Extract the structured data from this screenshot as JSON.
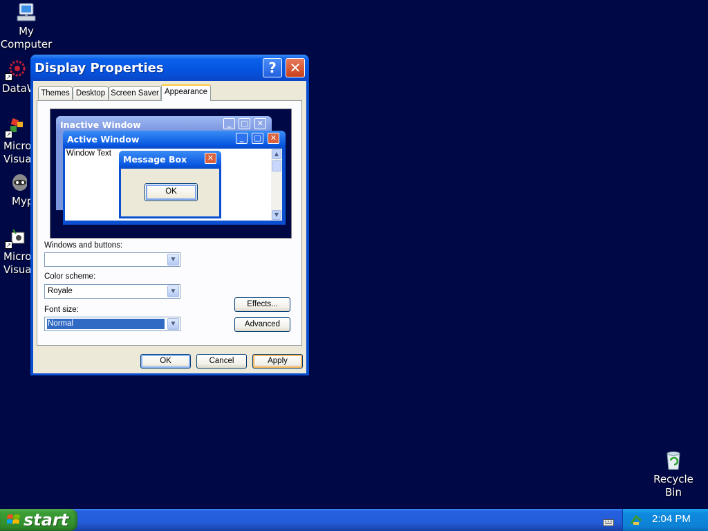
{
  "desktop": {
    "icons": [
      {
        "label": "My\nComputer",
        "name": "my-computer"
      },
      {
        "label": "DataW",
        "name": "dataw"
      },
      {
        "label": "Micro\nVisua",
        "name": "micro-visua-1"
      },
      {
        "label": "Myp",
        "name": "myp"
      },
      {
        "label": "Micro\nVisua",
        "name": "micro-visua-2"
      },
      {
        "label": "Recycle\nBin",
        "name": "recycle-bin"
      }
    ]
  },
  "dialog": {
    "title": "Display Properties",
    "help_glyph": "?",
    "close_glyph": "✕",
    "tabs": [
      "Themes",
      "Desktop",
      "Screen Saver",
      "Appearance"
    ],
    "active_tab": "Appearance",
    "preview": {
      "inactive_title": "Inactive Window",
      "active_title": "Active Window",
      "window_text": "Window Text",
      "message_title": "Message Box",
      "message_ok": "OK"
    },
    "fields": {
      "windows_buttons_label": "Windows and buttons:",
      "windows_buttons_value": "",
      "color_scheme_label": "Color scheme:",
      "color_scheme_value": "Royale",
      "font_size_label": "Font size:",
      "font_size_value": "Normal"
    },
    "buttons": {
      "effects": "Effects...",
      "advanced": "Advanced",
      "ok": "OK",
      "cancel": "Cancel",
      "apply": "Apply"
    }
  },
  "taskbar": {
    "start_label": "start",
    "clock": "2:04 PM"
  },
  "colors": {
    "desktop": "#000845",
    "titlebar": "#0554e0",
    "start": "#338f2e",
    "tray": "#0f8bdf"
  }
}
